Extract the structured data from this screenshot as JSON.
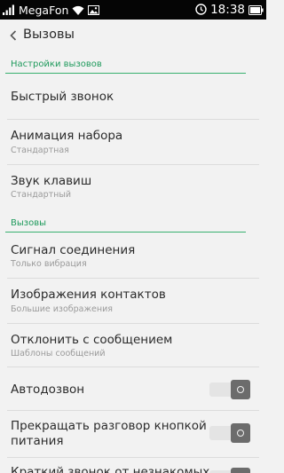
{
  "status_bar": {
    "carrier": "MegaFon",
    "time": "18:38",
    "icons": [
      "signal-icon",
      "wifi-icon",
      "image-notification-icon",
      "alarm-icon",
      "battery-icon"
    ]
  },
  "app_bar": {
    "back_icon": "chevron-left-icon",
    "title": "Вызовы"
  },
  "sections": [
    {
      "header": "Настройки вызовов"
    },
    {
      "header": "Вызовы"
    }
  ],
  "items": [
    {
      "title": "Быстрый звонок"
    },
    {
      "title": "Анимация набора",
      "subtitle": "Стандартная"
    },
    {
      "title": "Звук клавиш",
      "subtitle": "Стандартный"
    },
    {
      "title": "Сигнал соединения",
      "subtitle": "Только вибрация"
    },
    {
      "title": "Изображения контактов",
      "subtitle": "Большие изображения"
    },
    {
      "title": "Отклонить с сообщением",
      "subtitle": "Шаблоны сообщений"
    },
    {
      "title": "Автодозвон",
      "toggle": "off"
    },
    {
      "title_line1": "Прекращать разговор кнопкой",
      "title_line2": "питания",
      "toggle": "off"
    },
    {
      "title": "Краткий звонок от незнакомых",
      "toggle": "off"
    }
  ],
  "colors": {
    "accent": "#1f9a5c",
    "background": "#f2f2f2",
    "status_bar": "#050505",
    "toggle_knob": "#6c6c6c"
  }
}
